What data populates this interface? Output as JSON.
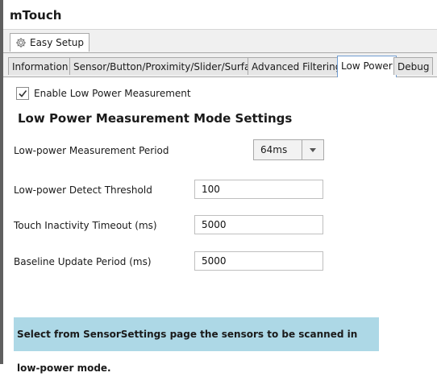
{
  "window": {
    "title": "mTouch"
  },
  "easy_tab": {
    "label": "Easy Setup",
    "icon": "gear-icon"
  },
  "tabs": [
    {
      "label": "Information"
    },
    {
      "label": "Sensor/Button/Proximity/Slider/Surface"
    },
    {
      "label": "Advanced Filtering"
    },
    {
      "label": "Low Power",
      "active": true
    },
    {
      "label": "Debug"
    }
  ],
  "low_power": {
    "enable_label": "Enable Low Power Measurement",
    "enable_checked": true,
    "section_title": "Low Power Measurement Mode Settings",
    "measurement_period": {
      "label": "Low-power Measurement Period",
      "value": "64ms"
    },
    "detect_threshold": {
      "label": "Low-power Detect Threshold",
      "value": "100"
    },
    "inactivity_timeout": {
      "label": "Touch Inactivity Timeout (ms)",
      "value": "5000"
    },
    "baseline_period": {
      "label": "Baseline Update Period (ms)",
      "value": "5000"
    },
    "info_text": "Select from SensorSettings page the sensors to be scanned in low-power mode."
  },
  "colors": {
    "banner": "#add8e6",
    "active_tab_border": "#6e9bd1"
  }
}
